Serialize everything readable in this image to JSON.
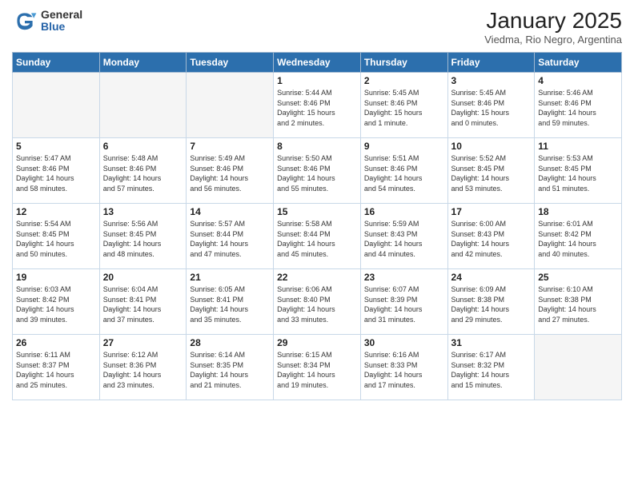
{
  "header": {
    "logo_general": "General",
    "logo_blue": "Blue",
    "month_title": "January 2025",
    "subtitle": "Viedma, Rio Negro, Argentina"
  },
  "weekdays": [
    "Sunday",
    "Monday",
    "Tuesday",
    "Wednesday",
    "Thursday",
    "Friday",
    "Saturday"
  ],
  "weeks": [
    [
      {
        "day": "",
        "text": ""
      },
      {
        "day": "",
        "text": ""
      },
      {
        "day": "",
        "text": ""
      },
      {
        "day": "1",
        "text": "Sunrise: 5:44 AM\nSunset: 8:46 PM\nDaylight: 15 hours\nand 2 minutes."
      },
      {
        "day": "2",
        "text": "Sunrise: 5:45 AM\nSunset: 8:46 PM\nDaylight: 15 hours\nand 1 minute."
      },
      {
        "day": "3",
        "text": "Sunrise: 5:45 AM\nSunset: 8:46 PM\nDaylight: 15 hours\nand 0 minutes."
      },
      {
        "day": "4",
        "text": "Sunrise: 5:46 AM\nSunset: 8:46 PM\nDaylight: 14 hours\nand 59 minutes."
      }
    ],
    [
      {
        "day": "5",
        "text": "Sunrise: 5:47 AM\nSunset: 8:46 PM\nDaylight: 14 hours\nand 58 minutes."
      },
      {
        "day": "6",
        "text": "Sunrise: 5:48 AM\nSunset: 8:46 PM\nDaylight: 14 hours\nand 57 minutes."
      },
      {
        "day": "7",
        "text": "Sunrise: 5:49 AM\nSunset: 8:46 PM\nDaylight: 14 hours\nand 56 minutes."
      },
      {
        "day": "8",
        "text": "Sunrise: 5:50 AM\nSunset: 8:46 PM\nDaylight: 14 hours\nand 55 minutes."
      },
      {
        "day": "9",
        "text": "Sunrise: 5:51 AM\nSunset: 8:46 PM\nDaylight: 14 hours\nand 54 minutes."
      },
      {
        "day": "10",
        "text": "Sunrise: 5:52 AM\nSunset: 8:45 PM\nDaylight: 14 hours\nand 53 minutes."
      },
      {
        "day": "11",
        "text": "Sunrise: 5:53 AM\nSunset: 8:45 PM\nDaylight: 14 hours\nand 51 minutes."
      }
    ],
    [
      {
        "day": "12",
        "text": "Sunrise: 5:54 AM\nSunset: 8:45 PM\nDaylight: 14 hours\nand 50 minutes."
      },
      {
        "day": "13",
        "text": "Sunrise: 5:56 AM\nSunset: 8:45 PM\nDaylight: 14 hours\nand 48 minutes."
      },
      {
        "day": "14",
        "text": "Sunrise: 5:57 AM\nSunset: 8:44 PM\nDaylight: 14 hours\nand 47 minutes."
      },
      {
        "day": "15",
        "text": "Sunrise: 5:58 AM\nSunset: 8:44 PM\nDaylight: 14 hours\nand 45 minutes."
      },
      {
        "day": "16",
        "text": "Sunrise: 5:59 AM\nSunset: 8:43 PM\nDaylight: 14 hours\nand 44 minutes."
      },
      {
        "day": "17",
        "text": "Sunrise: 6:00 AM\nSunset: 8:43 PM\nDaylight: 14 hours\nand 42 minutes."
      },
      {
        "day": "18",
        "text": "Sunrise: 6:01 AM\nSunset: 8:42 PM\nDaylight: 14 hours\nand 40 minutes."
      }
    ],
    [
      {
        "day": "19",
        "text": "Sunrise: 6:03 AM\nSunset: 8:42 PM\nDaylight: 14 hours\nand 39 minutes."
      },
      {
        "day": "20",
        "text": "Sunrise: 6:04 AM\nSunset: 8:41 PM\nDaylight: 14 hours\nand 37 minutes."
      },
      {
        "day": "21",
        "text": "Sunrise: 6:05 AM\nSunset: 8:41 PM\nDaylight: 14 hours\nand 35 minutes."
      },
      {
        "day": "22",
        "text": "Sunrise: 6:06 AM\nSunset: 8:40 PM\nDaylight: 14 hours\nand 33 minutes."
      },
      {
        "day": "23",
        "text": "Sunrise: 6:07 AM\nSunset: 8:39 PM\nDaylight: 14 hours\nand 31 minutes."
      },
      {
        "day": "24",
        "text": "Sunrise: 6:09 AM\nSunset: 8:38 PM\nDaylight: 14 hours\nand 29 minutes."
      },
      {
        "day": "25",
        "text": "Sunrise: 6:10 AM\nSunset: 8:38 PM\nDaylight: 14 hours\nand 27 minutes."
      }
    ],
    [
      {
        "day": "26",
        "text": "Sunrise: 6:11 AM\nSunset: 8:37 PM\nDaylight: 14 hours\nand 25 minutes."
      },
      {
        "day": "27",
        "text": "Sunrise: 6:12 AM\nSunset: 8:36 PM\nDaylight: 14 hours\nand 23 minutes."
      },
      {
        "day": "28",
        "text": "Sunrise: 6:14 AM\nSunset: 8:35 PM\nDaylight: 14 hours\nand 21 minutes."
      },
      {
        "day": "29",
        "text": "Sunrise: 6:15 AM\nSunset: 8:34 PM\nDaylight: 14 hours\nand 19 minutes."
      },
      {
        "day": "30",
        "text": "Sunrise: 6:16 AM\nSunset: 8:33 PM\nDaylight: 14 hours\nand 17 minutes."
      },
      {
        "day": "31",
        "text": "Sunrise: 6:17 AM\nSunset: 8:32 PM\nDaylight: 14 hours\nand 15 minutes."
      },
      {
        "day": "",
        "text": ""
      }
    ]
  ]
}
